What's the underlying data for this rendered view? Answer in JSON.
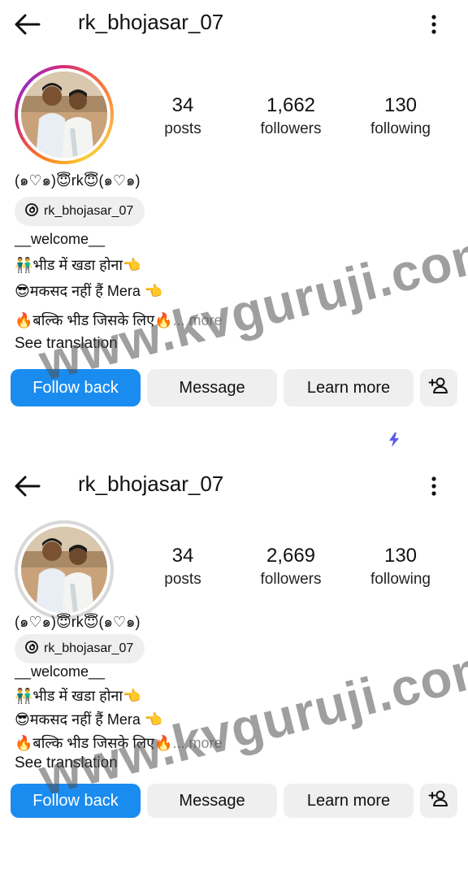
{
  "screenshots": [
    {
      "username": "rk_bhojasar_07",
      "stats": {
        "posts_count": "34",
        "posts_label": "posts",
        "followers_count": "1,662",
        "followers_label": "followers",
        "following_count": "130",
        "following_label": "following"
      },
      "display_name": "(๑♡๑)😇rk😇(๑♡๑)",
      "threads_handle": "rk_bhojasar_07",
      "bio": {
        "line1": "__welcome__",
        "line2": "👬भीड में खडा होना👈",
        "line3": "😎मकसद नहीं हैं Mera 👈",
        "line4": "🔥बल्कि भीड जिसके लिए🔥",
        "more": "... more"
      },
      "see_translation": "See translation",
      "buttons": {
        "follow_back": "Follow back",
        "message": "Message",
        "learn_more": "Learn more"
      },
      "avatar_ring": "story-gradient"
    },
    {
      "username": "rk_bhojasar_07",
      "stats": {
        "posts_count": "34",
        "posts_label": "posts",
        "followers_count": "2,669",
        "followers_label": "followers",
        "following_count": "130",
        "following_label": "following"
      },
      "display_name": "(๑♡๑)😇rk😇(๑♡๑)",
      "threads_handle": "rk_bhojasar_07",
      "bio": {
        "line1": "__welcome__",
        "line2": "👬भीड में खडा होना👈",
        "line3": "😎मकसद नहीं हैं Mera 👈",
        "line4": "🔥बल्कि भीड जिसके लिए🔥",
        "more": "... more"
      },
      "see_translation": "See translation",
      "buttons": {
        "follow_back": "Follow back",
        "message": "Message",
        "learn_more": "Learn more"
      },
      "avatar_ring": "seen-grey"
    }
  ],
  "watermark": "www.kvguruji.com",
  "colors": {
    "primary_button": "#1a8cf0",
    "secondary_button": "#efefef",
    "bolt": "#5b5ce6"
  },
  "icons": [
    "back-arrow-icon",
    "kebab-menu-icon",
    "threads-icon",
    "add-person-icon",
    "lightning-bolt-icon"
  ]
}
